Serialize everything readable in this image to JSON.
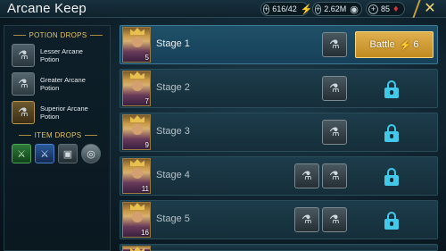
{
  "header": {
    "title": "Arcane Keep",
    "energy": "616/42",
    "silver": "2.62M",
    "gems": "85",
    "energy_icon": "lightning-icon",
    "silver_icon": "silver-coin-icon",
    "gem_icon": "ruby-icon",
    "close_icon": "close-icon"
  },
  "left_panel": {
    "potion_heading": "POTION DROPS",
    "potions": [
      {
        "label": "Lesser Arcane Potion",
        "icon": "potion-icon",
        "tier": "lesser"
      },
      {
        "label": "Greater Arcane Potion",
        "icon": "potion-icon",
        "tier": "greater"
      },
      {
        "label": "Superior Arcane Potion",
        "icon": "potion-icon",
        "tier": "superior"
      }
    ],
    "item_heading": "ITEM DROPS",
    "items": [
      {
        "icon": "green-sword-icon",
        "color": "#2f7a3a"
      },
      {
        "icon": "blue-sword-icon",
        "color": "#2a5a9a"
      },
      {
        "icon": "chest-icon",
        "color": "#4a5860"
      },
      {
        "icon": "silver-coin-icon",
        "color": "#7a8a90"
      }
    ]
  },
  "stages": [
    {
      "name": "Stage 1",
      "level": "5",
      "locked": false,
      "drops": 1,
      "battle_label": "Battle",
      "energy_cost": "6"
    },
    {
      "name": "Stage 2",
      "level": "7",
      "locked": true,
      "drops": 1
    },
    {
      "name": "Stage 3",
      "level": "9",
      "locked": true,
      "drops": 1
    },
    {
      "name": "Stage 4",
      "level": "11",
      "locked": true,
      "drops": 2
    },
    {
      "name": "Stage 5",
      "level": "16",
      "locked": true,
      "drops": 2
    }
  ],
  "colors": {
    "accent_gold": "#e0b050",
    "lock_cyan": "#42c8e8",
    "panel_bg": "#152e3a"
  }
}
